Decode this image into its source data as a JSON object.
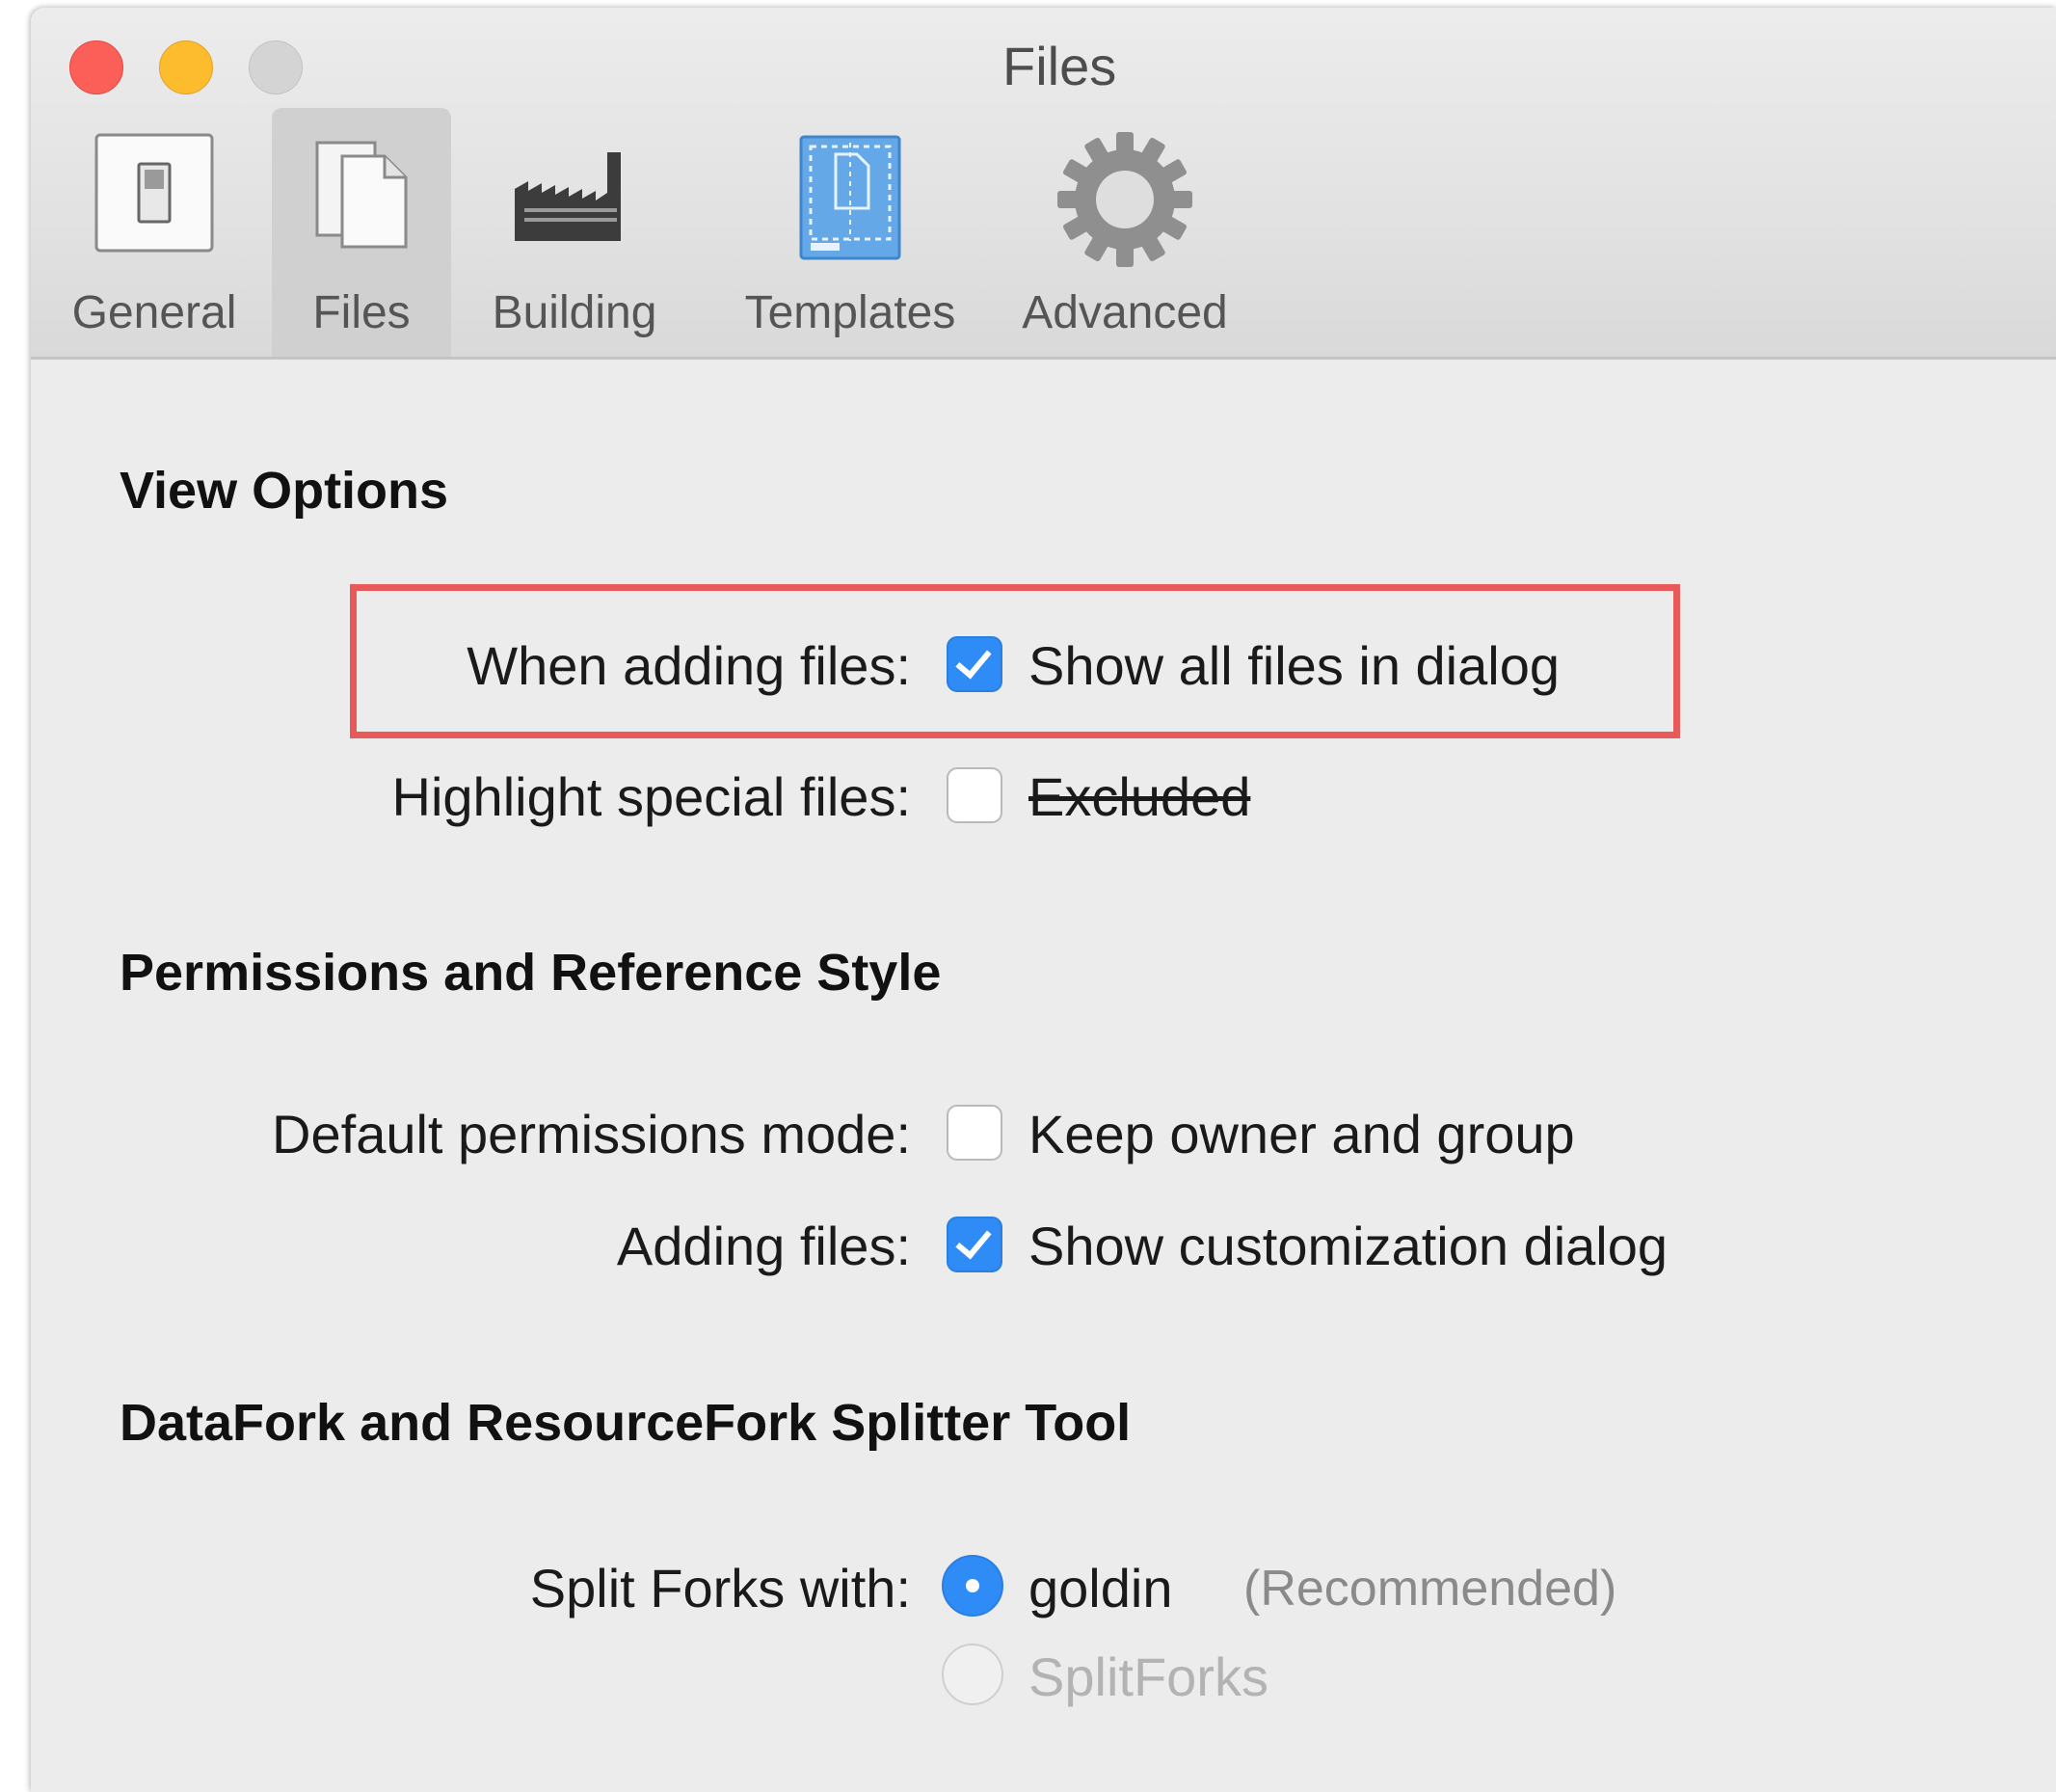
{
  "window": {
    "title": "Files"
  },
  "toolbar": {
    "tabs": [
      {
        "label": "General",
        "icon": "switch-icon"
      },
      {
        "label": "Files",
        "icon": "documents-icon"
      },
      {
        "label": "Building",
        "icon": "factory-icon"
      },
      {
        "label": "Templates",
        "icon": "template-icon"
      },
      {
        "label": "Advanced",
        "icon": "gear-icon"
      }
    ],
    "selected": "Files"
  },
  "sections": {
    "view_options": {
      "title": "View Options",
      "adding_label": "When adding files:",
      "adding_option": "Show all files in dialog",
      "adding_checked": true,
      "highlight_label": "Highlight special files:",
      "highlight_option": "Excluded",
      "highlight_checked": false
    },
    "permissions": {
      "title": "Permissions and Reference Style",
      "mode_label": "Default permissions mode:",
      "mode_option": "Keep owner and group",
      "mode_checked": false,
      "adding_label": "Adding files:",
      "adding_option": "Show customization dialog",
      "adding_checked": true
    },
    "splitter": {
      "title": "DataFork and ResourceFork Splitter Tool",
      "split_label": "Split Forks with:",
      "option1": "goldin",
      "option1_note": "(Recommended)",
      "option2": "SplitForks",
      "selected": "goldin"
    }
  },
  "colors": {
    "accent": "#2f8bf5",
    "highlight_border": "#e85a5a",
    "close": "#fc5f57",
    "minimize": "#fdbc2e",
    "zoom_disabled": "#d4d4d4"
  }
}
